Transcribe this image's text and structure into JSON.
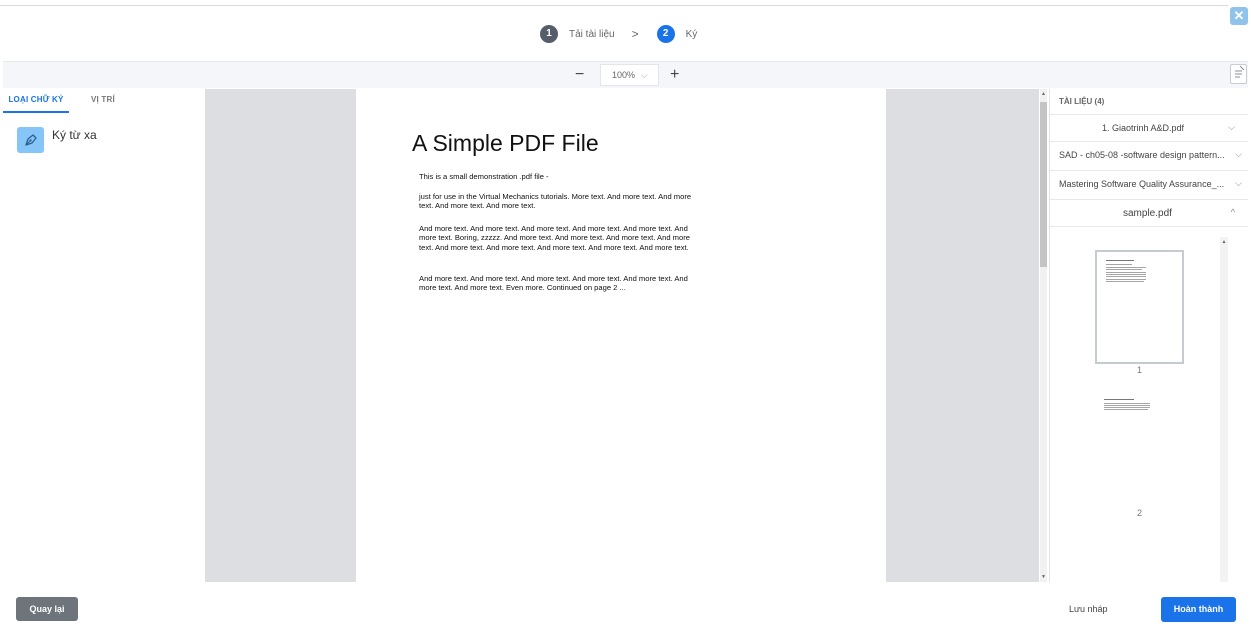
{
  "stepper": {
    "steps": [
      {
        "number": "1",
        "label": "Tải tài liệu"
      },
      {
        "number": "2",
        "label": "Ký"
      }
    ],
    "separator": ">"
  },
  "toolbar": {
    "zoom_minus": "−",
    "zoom_value": "100%",
    "zoom_plus": "+"
  },
  "left_panel": {
    "tabs": [
      "LOẠI CHỮ KÝ",
      "VỊ TRÍ"
    ],
    "active_tab": "LOẠI CHỮ KÝ",
    "sign_types": [
      {
        "label": "Ký từ xa",
        "icon": "pen-nib-icon"
      }
    ]
  },
  "document": {
    "title": "A Simple PDF File",
    "paragraphs": [
      "This is a small demonstration .pdf file -",
      "just for use in the Virtual Mechanics tutorials. More text. And more text. And more text. And more text. And more text.",
      "And more text. And more text. And more text. And more text. And more text. And more text. Boring, zzzzz. And more text. And more text. And more text. And more text. And more text. And more text. And more text. And more text. And more text.",
      "And more text. And more text. And more text. And more text. And more text. And more text. And more text. Even more. Continued on page 2 ..."
    ]
  },
  "right_panel": {
    "title": "TÀI LIỆU (4)",
    "documents": [
      {
        "name": "1. Giaotrinh A&D.pdf",
        "expanded": false
      },
      {
        "name": "SAD - ch05-08 -software design pattern...",
        "expanded": false
      },
      {
        "name": "Mastering Software Quality Assurance_...",
        "expanded": false
      },
      {
        "name": "sample.pdf",
        "expanded": true
      }
    ],
    "page_numbers": [
      "1",
      "2"
    ]
  },
  "footer": {
    "back_label": "Quay lại",
    "draft_label": "Lưu nháp",
    "finish_label": "Hoàn thành"
  },
  "colors": {
    "accent": "#1a73e8",
    "step_done": "#555e69",
    "close_button": "#8fc3ec",
    "sign_icon_bg": "#85c5f7",
    "back_button": "#6d747c",
    "viewer_bg": "#dcdee2"
  }
}
